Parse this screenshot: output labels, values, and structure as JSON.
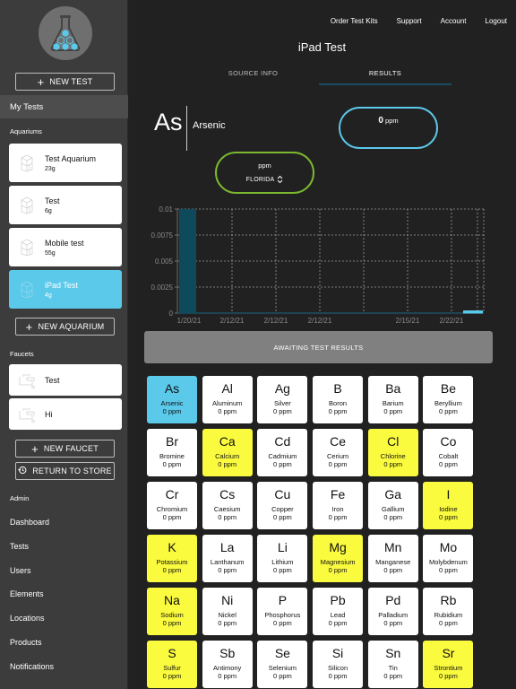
{
  "sidebar": {
    "new_test_label": "NEW TEST",
    "my_tests_label": "My Tests",
    "aquariums_heading": "Aquariums",
    "aquariums": [
      {
        "name": "Test Aquarium",
        "size": "23g",
        "icon": "aquarium-icon",
        "active": false
      },
      {
        "name": "Test",
        "size": "6g",
        "icon": "aquarium-icon",
        "active": false
      },
      {
        "name": "Mobile test",
        "size": "55g",
        "icon": "aquarium-icon",
        "active": false
      },
      {
        "name": "iPad Test",
        "size": "4g",
        "icon": "aquarium-icon",
        "active": true
      }
    ],
    "new_aquarium_label": "NEW AQUARIUM",
    "faucets_heading": "Faucets",
    "faucets": [
      {
        "name": "Test",
        "icon": "faucet-icon"
      },
      {
        "name": "Hi",
        "icon": "faucet-icon"
      }
    ],
    "new_faucet_label": "NEW FAUCET",
    "return_label": "RETURN TO STORE",
    "admin_heading": "Admin",
    "admin_items": [
      "Dashboard",
      "Tests",
      "Users",
      "Elements",
      "Locations",
      "Products",
      "Notifications"
    ]
  },
  "topnav": [
    "Order Test Kits",
    "Support",
    "Account",
    "Logout"
  ],
  "page_title": "iPad Test",
  "tabs": [
    {
      "label": "SOURCE INFO",
      "active": false
    },
    {
      "label": "RESULTS",
      "active": true
    }
  ],
  "element": {
    "symbol": "As",
    "name": "Arsenic",
    "value": "0",
    "unit": "ppm",
    "limit_unit": "ppm",
    "location": "FLORIDA"
  },
  "colors": {
    "accent_blue": "#5bc9ea",
    "accent_green": "#7cb82f",
    "highlight_yellow": "#fafa3e",
    "chart_bar": "#0f4a5c"
  },
  "chart_data": {
    "type": "bar",
    "title": "",
    "xlabel": "",
    "ylabel": "",
    "ylim": [
      0,
      0.01
    ],
    "yticks": [
      0,
      0.0025,
      0.005,
      0.0075,
      0.01
    ],
    "ytick_labels": [
      "0",
      "0.0025",
      "0.005",
      "0.0075",
      "0.01"
    ],
    "categories": [
      "1/20/21",
      "2/12/21",
      "2/12/21",
      "2/12/21",
      "",
      "2/15/21",
      "2/22/21",
      ""
    ],
    "values": [
      0.01,
      0,
      0,
      0,
      0,
      0,
      0,
      0
    ],
    "highlight_index": 7,
    "grid": true
  },
  "awaiting_label": "AWAITING TEST RESULTS",
  "elements": [
    {
      "symbol": "As",
      "name": "Arsenic",
      "value": "0 ppm",
      "state": "selected"
    },
    {
      "symbol": "Al",
      "name": "Aluminum",
      "value": "0 ppm",
      "state": "normal"
    },
    {
      "symbol": "Ag",
      "name": "Silver",
      "value": "0 ppm",
      "state": "normal"
    },
    {
      "symbol": "B",
      "name": "Boron",
      "value": "0 ppm",
      "state": "normal"
    },
    {
      "symbol": "Ba",
      "name": "Barium",
      "value": "0 ppm",
      "state": "normal"
    },
    {
      "symbol": "Be",
      "name": "Beryllium",
      "value": "0 ppm",
      "state": "normal"
    },
    {
      "symbol": "Br",
      "name": "Bromine",
      "value": "0 ppm",
      "state": "normal"
    },
    {
      "symbol": "Ca",
      "name": "Calcium",
      "value": "0 ppm",
      "state": "flagged"
    },
    {
      "symbol": "Cd",
      "name": "Cadmium",
      "value": "0 ppm",
      "state": "normal"
    },
    {
      "symbol": "Ce",
      "name": "Cerium",
      "value": "0 ppm",
      "state": "normal"
    },
    {
      "symbol": "Cl",
      "name": "Chlorine",
      "value": "0 ppm",
      "state": "flagged"
    },
    {
      "symbol": "Co",
      "name": "Cobalt",
      "value": "0 ppm",
      "state": "normal"
    },
    {
      "symbol": "Cr",
      "name": "Chromium",
      "value": "0 ppm",
      "state": "normal"
    },
    {
      "symbol": "Cs",
      "name": "Caesium",
      "value": "0 ppm",
      "state": "normal"
    },
    {
      "symbol": "Cu",
      "name": "Copper",
      "value": "0 ppm",
      "state": "normal"
    },
    {
      "symbol": "Fe",
      "name": "Iron",
      "value": "0 ppm",
      "state": "normal"
    },
    {
      "symbol": "Ga",
      "name": "Gallium",
      "value": "0 ppm",
      "state": "normal"
    },
    {
      "symbol": "I",
      "name": "Iodine",
      "value": "0 ppm",
      "state": "flagged"
    },
    {
      "symbol": "K",
      "name": "Potassium",
      "value": "0 ppm",
      "state": "flagged"
    },
    {
      "symbol": "La",
      "name": "Lanthanum",
      "value": "0 ppm",
      "state": "normal"
    },
    {
      "symbol": "Li",
      "name": "Lithium",
      "value": "0 ppm",
      "state": "normal"
    },
    {
      "symbol": "Mg",
      "name": "Magnesium",
      "value": "0 ppm",
      "state": "flagged"
    },
    {
      "symbol": "Mn",
      "name": "Manganese",
      "value": "0 ppm",
      "state": "normal"
    },
    {
      "symbol": "Mo",
      "name": "Molybdenum",
      "value": "0 ppm",
      "state": "normal"
    },
    {
      "symbol": "Na",
      "name": "Sodium",
      "value": "0 ppm",
      "state": "flagged"
    },
    {
      "symbol": "Ni",
      "name": "Nickel",
      "value": "0 ppm",
      "state": "normal"
    },
    {
      "symbol": "P",
      "name": "Phosphorus",
      "value": "0 ppm",
      "state": "normal"
    },
    {
      "symbol": "Pb",
      "name": "Lead",
      "value": "0 ppm",
      "state": "normal"
    },
    {
      "symbol": "Pd",
      "name": "Palladium",
      "value": "0 ppm",
      "state": "normal"
    },
    {
      "symbol": "Rb",
      "name": "Rubidium",
      "value": "0 ppm",
      "state": "normal"
    },
    {
      "symbol": "S",
      "name": "Sulfur",
      "value": "0 ppm",
      "state": "flagged"
    },
    {
      "symbol": "Sb",
      "name": "Antimony",
      "value": "0 ppm",
      "state": "normal"
    },
    {
      "symbol": "Se",
      "name": "Selenium",
      "value": "0 ppm",
      "state": "normal"
    },
    {
      "symbol": "Si",
      "name": "Silicon",
      "value": "0 ppm",
      "state": "normal"
    },
    {
      "symbol": "Sn",
      "name": "Tin",
      "value": "0 ppm",
      "state": "normal"
    },
    {
      "symbol": "Sr",
      "name": "Strontium",
      "value": "0 ppm",
      "state": "flagged"
    }
  ]
}
